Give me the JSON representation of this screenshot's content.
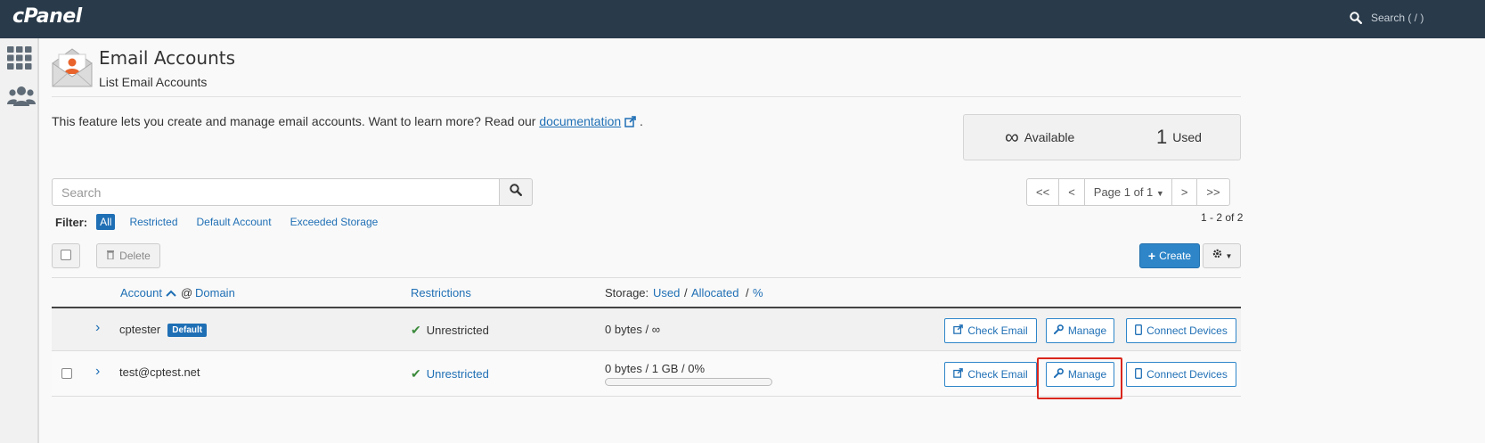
{
  "topbar": {
    "logo": "cPanel",
    "search_placeholder": "Search ( / )"
  },
  "sidebar": {
    "items": [
      {
        "icon": "grid-icon"
      },
      {
        "icon": "users-icon"
      }
    ]
  },
  "header": {
    "title": "Email Accounts",
    "subtitle": "List Email Accounts"
  },
  "intro": {
    "text": "This feature lets you create and manage email accounts. Want to learn more? Read our ",
    "link": "documentation",
    "end": "."
  },
  "stats": {
    "available_value": "∞",
    "available_label": "Available",
    "used_value": "1",
    "used_label": "Used"
  },
  "search": {
    "placeholder": "Search"
  },
  "filter": {
    "label": "Filter:",
    "items": [
      "All",
      "Restricted",
      "Default Account",
      "Exceeded Storage"
    ],
    "active": "All"
  },
  "pager": {
    "first": "<<",
    "prev": "<",
    "page": "Page 1 of 1",
    "next": ">",
    "last": ">>",
    "count": "1 - 2 of 2"
  },
  "toolbar": {
    "delete_label": "Delete",
    "create_label": "Create"
  },
  "table": {
    "headers": {
      "account": "Account",
      "at": "@",
      "domain": "Domain",
      "restrictions": "Restrictions",
      "storage": "Storage:",
      "used": "Used",
      "sep1": "/",
      "allocated": "Allocated",
      "sep2": "/",
      "percent": "%"
    },
    "rows": [
      {
        "account": "cptester",
        "badge": "Default",
        "restriction": "Unrestricted",
        "storage": "0 bytes / ∞",
        "usage_fraction": 0
      },
      {
        "account": "test@cptest.net",
        "badge": "",
        "restriction": "Unrestricted",
        "storage": "0 bytes / 1 GB / 0%",
        "usage_fraction": 0
      }
    ],
    "actions": {
      "check_email": "Check Email",
      "manage": "Manage",
      "connect_devices": "Connect Devices"
    }
  },
  "colors": {
    "topbar": "#293a4a",
    "accent": "#1f6fb5",
    "primary_button": "#2e86c9",
    "highlight": "#d9261c",
    "success": "#3c8a3c"
  }
}
